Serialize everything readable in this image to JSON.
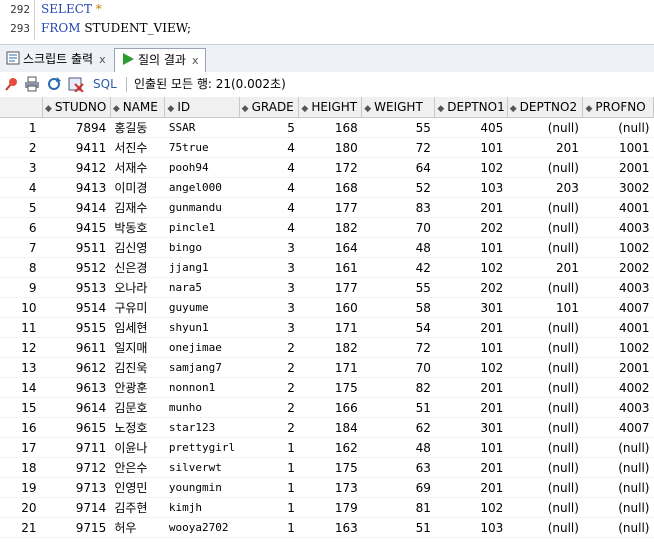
{
  "editor": {
    "lines": [
      {
        "no": "292",
        "keyword": "SELECT",
        "rest": " *"
      },
      {
        "no": "293",
        "keyword": "FROM",
        "rest": " STUDENT_VIEW;"
      }
    ]
  },
  "tabs": [
    {
      "label": "스크립트 출력",
      "close": "x"
    },
    {
      "label": "질의 결과",
      "close": "x"
    }
  ],
  "toolbar": {
    "sql_label": "SQL",
    "status": "인출된 모든 행: 21(0.002초)"
  },
  "grid": {
    "columns": [
      "STUDNO",
      "NAME",
      "ID",
      "GRADE",
      "HEIGHT",
      "WEIGHT",
      "DEPTNO1",
      "DEPTNO2",
      "PROFNO"
    ],
    "rows": [
      {
        "n": "1",
        "studno": "7894",
        "name": "홍길동",
        "id": "SSAR",
        "grade": "5",
        "height": "168",
        "weight": "55",
        "deptno1": "405",
        "deptno2": "(null)",
        "profno": "(null)"
      },
      {
        "n": "2",
        "studno": "9411",
        "name": "서진수",
        "id": "75true",
        "grade": "4",
        "height": "180",
        "weight": "72",
        "deptno1": "101",
        "deptno2": "201",
        "profno": "1001"
      },
      {
        "n": "3",
        "studno": "9412",
        "name": "서재수",
        "id": "pooh94",
        "grade": "4",
        "height": "172",
        "weight": "64",
        "deptno1": "102",
        "deptno2": "(null)",
        "profno": "2001"
      },
      {
        "n": "4",
        "studno": "9413",
        "name": "이미경",
        "id": "angel000",
        "grade": "4",
        "height": "168",
        "weight": "52",
        "deptno1": "103",
        "deptno2": "203",
        "profno": "3002"
      },
      {
        "n": "5",
        "studno": "9414",
        "name": "김재수",
        "id": "gunmandu",
        "grade": "4",
        "height": "177",
        "weight": "83",
        "deptno1": "201",
        "deptno2": "(null)",
        "profno": "4001"
      },
      {
        "n": "6",
        "studno": "9415",
        "name": "박동호",
        "id": "pincle1",
        "grade": "4",
        "height": "182",
        "weight": "70",
        "deptno1": "202",
        "deptno2": "(null)",
        "profno": "4003"
      },
      {
        "n": "7",
        "studno": "9511",
        "name": "김신영",
        "id": "bingo",
        "grade": "3",
        "height": "164",
        "weight": "48",
        "deptno1": "101",
        "deptno2": "(null)",
        "profno": "1002"
      },
      {
        "n": "8",
        "studno": "9512",
        "name": "신은경",
        "id": "jjang1",
        "grade": "3",
        "height": "161",
        "weight": "42",
        "deptno1": "102",
        "deptno2": "201",
        "profno": "2002"
      },
      {
        "n": "9",
        "studno": "9513",
        "name": "오나라",
        "id": "nara5",
        "grade": "3",
        "height": "177",
        "weight": "55",
        "deptno1": "202",
        "deptno2": "(null)",
        "profno": "4003"
      },
      {
        "n": "10",
        "studno": "9514",
        "name": "구유미",
        "id": "guyume",
        "grade": "3",
        "height": "160",
        "weight": "58",
        "deptno1": "301",
        "deptno2": "101",
        "profno": "4007"
      },
      {
        "n": "11",
        "studno": "9515",
        "name": "임세현",
        "id": "shyun1",
        "grade": "3",
        "height": "171",
        "weight": "54",
        "deptno1": "201",
        "deptno2": "(null)",
        "profno": "4001"
      },
      {
        "n": "12",
        "studno": "9611",
        "name": "일지매",
        "id": "onejimae",
        "grade": "2",
        "height": "182",
        "weight": "72",
        "deptno1": "101",
        "deptno2": "(null)",
        "profno": "1002"
      },
      {
        "n": "13",
        "studno": "9612",
        "name": "김진욱",
        "id": "samjang7",
        "grade": "2",
        "height": "171",
        "weight": "70",
        "deptno1": "102",
        "deptno2": "(null)",
        "profno": "2001"
      },
      {
        "n": "14",
        "studno": "9613",
        "name": "안광훈",
        "id": "nonnon1",
        "grade": "2",
        "height": "175",
        "weight": "82",
        "deptno1": "201",
        "deptno2": "(null)",
        "profno": "4002"
      },
      {
        "n": "15",
        "studno": "9614",
        "name": "김문호",
        "id": "munho",
        "grade": "2",
        "height": "166",
        "weight": "51",
        "deptno1": "201",
        "deptno2": "(null)",
        "profno": "4003"
      },
      {
        "n": "16",
        "studno": "9615",
        "name": "노정호",
        "id": "star123",
        "grade": "2",
        "height": "184",
        "weight": "62",
        "deptno1": "301",
        "deptno2": "(null)",
        "profno": "4007"
      },
      {
        "n": "17",
        "studno": "9711",
        "name": "이윤나",
        "id": "prettygirl",
        "grade": "1",
        "height": "162",
        "weight": "48",
        "deptno1": "101",
        "deptno2": "(null)",
        "profno": "(null)"
      },
      {
        "n": "18",
        "studno": "9712",
        "name": "안은수",
        "id": "silverwt",
        "grade": "1",
        "height": "175",
        "weight": "63",
        "deptno1": "201",
        "deptno2": "(null)",
        "profno": "(null)"
      },
      {
        "n": "19",
        "studno": "9713",
        "name": "인영민",
        "id": "youngmin",
        "grade": "1",
        "height": "173",
        "weight": "69",
        "deptno1": "201",
        "deptno2": "(null)",
        "profno": "(null)"
      },
      {
        "n": "20",
        "studno": "9714",
        "name": "김주현",
        "id": "kimjh",
        "grade": "1",
        "height": "179",
        "weight": "81",
        "deptno1": "102",
        "deptno2": "(null)",
        "profno": "(null)"
      },
      {
        "n": "21",
        "studno": "9715",
        "name": "허우",
        "id": "wooya2702",
        "grade": "1",
        "height": "163",
        "weight": "51",
        "deptno1": "103",
        "deptno2": "(null)",
        "profno": "(null)"
      }
    ]
  }
}
